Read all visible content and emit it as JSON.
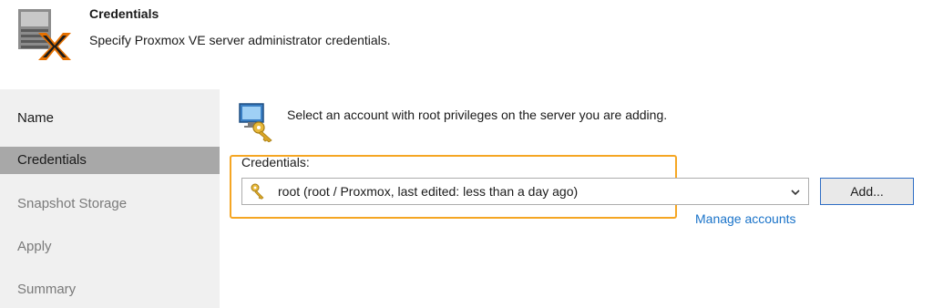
{
  "header": {
    "title": "Credentials",
    "subtitle": "Specify Proxmox VE server administrator credentials."
  },
  "sidebar": {
    "items": [
      {
        "label": "Name",
        "state": "done"
      },
      {
        "label": "Credentials",
        "state": "active"
      },
      {
        "label": "Snapshot Storage",
        "state": "pending"
      },
      {
        "label": "Apply",
        "state": "pending"
      },
      {
        "label": "Summary",
        "state": "pending"
      }
    ]
  },
  "main": {
    "info_text": "Select an account with root privileges on the server you are adding.",
    "credentials_label": "Credentials:",
    "credentials_value": "root (root / Proxmox, last edited: less than a day ago)",
    "add_button": "Add...",
    "manage_link": "Manage accounts"
  },
  "colors": {
    "highlight": "#f5a623",
    "link": "#1a73c9",
    "sidebar_bg": "#f0f0f0",
    "sidebar_active": "#a8a8a8",
    "proxmox_orange": "#e57000"
  },
  "icons": {
    "header": "proxmox-server-icon",
    "info": "computer-key-icon",
    "select": "key-icon",
    "dropdown": "chevron-down-icon"
  }
}
